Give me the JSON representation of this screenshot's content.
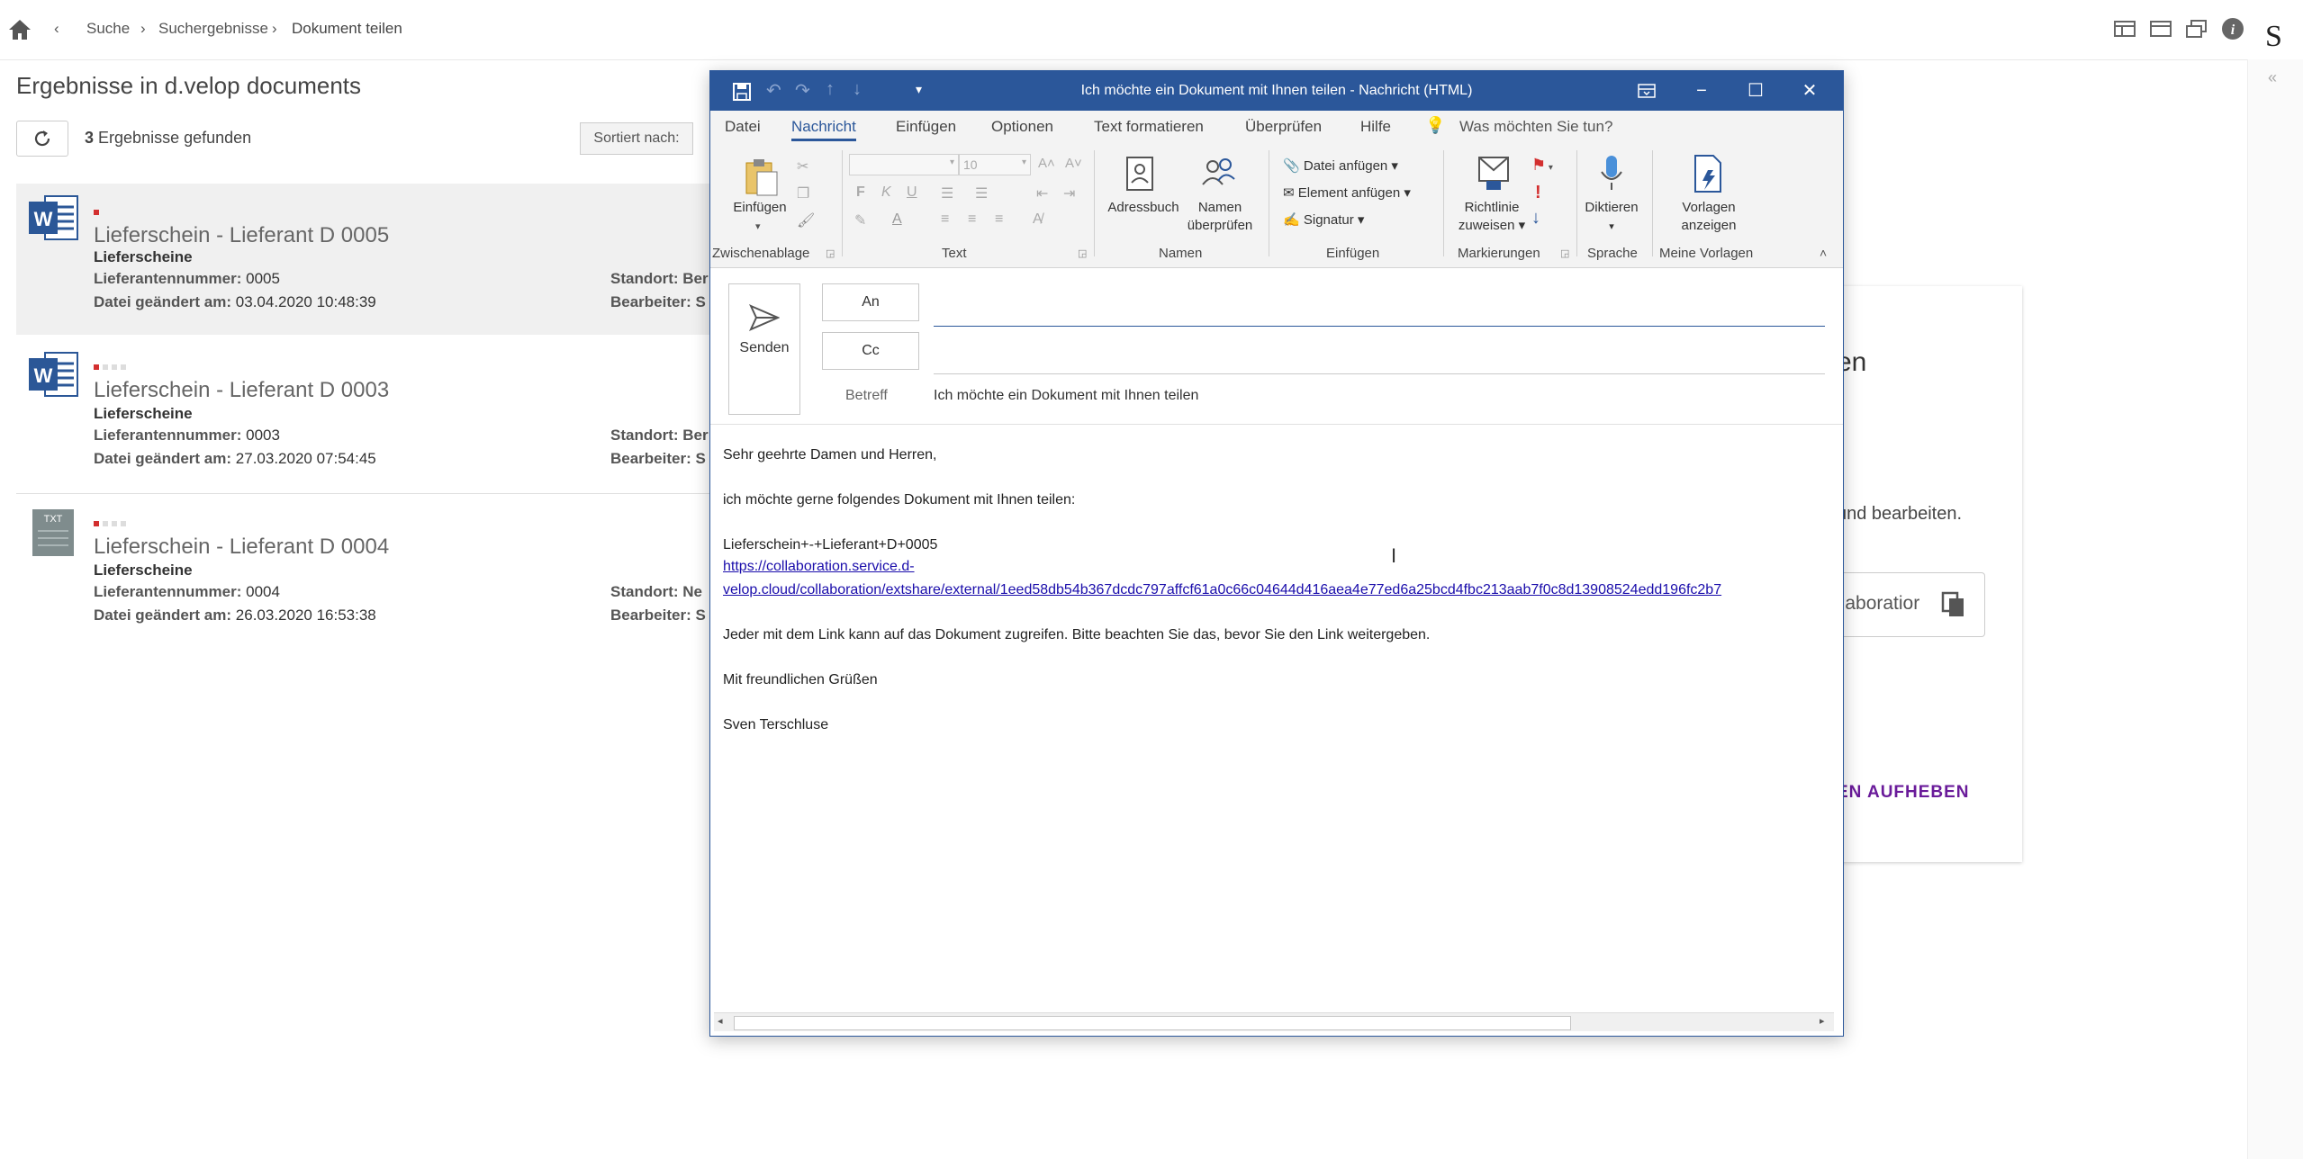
{
  "breadcrumb": {
    "home": "home",
    "items": [
      "Suche",
      "Suchergebnisse",
      "Dokument teilen"
    ]
  },
  "results": {
    "title": "Ergebnisse in d.velop documents",
    "count_num": "3",
    "count_text": "Ergebnisse gefunden",
    "sort_label": "Sortiert nach:",
    "items": [
      {
        "icon": "word-icon",
        "title": "Lieferschein - Lieferant D 0005",
        "category": "Lieferscheine",
        "f1_label": "Lieferantennummer:",
        "f1_value": "0005",
        "f2_label": "Datei geändert am:",
        "f2_value": "03.04.2020 10:48:39",
        "r1": "Standort: Ber",
        "r2": "Bearbeiter: S"
      },
      {
        "icon": "word-icon",
        "title": "Lieferschein - Lieferant D 0003",
        "category": "Lieferscheine",
        "f1_label": "Lieferantennummer:",
        "f1_value": "0003",
        "f2_label": "Datei geändert am:",
        "f2_value": "27.03.2020 07:54:45",
        "r1": "Standort: Ber",
        "r2": "Bearbeiter: S"
      },
      {
        "icon": "txt-icon",
        "title": "Lieferschein - Lieferant D 0004",
        "category": "Lieferscheine",
        "f1_label": "Lieferantennummer:",
        "f1_value": "0004",
        "f2_label": "Datei geändert am:",
        "f2_value": "26.03.2020 16:53:38",
        "r1": "Standort: Ne",
        "r2": "Bearbeiter: S"
      }
    ]
  },
  "background_panel": {
    "heading_fragment": "en",
    "text_fragment": "und bearbeiten.",
    "button_fragment": "llaboratior",
    "action_fragment": "EN AUFHEBEN"
  },
  "window": {
    "title": "Ich möchte ein Dokument mit Ihnen teilen  -  Nachricht (HTML)",
    "menu": [
      "Datei",
      "Nachricht",
      "Einfügen",
      "Optionen",
      "Text formatieren",
      "Überprüfen",
      "Hilfe"
    ],
    "tell_me": "Was möchten Sie tun?",
    "ribbon": {
      "paste": "Einfügen",
      "font_size": "10",
      "addressbook": "Adressbuch",
      "check_names_1": "Namen",
      "check_names_2": "überprüfen",
      "attach_file": "Datei anfügen",
      "attach_item": "Element anfügen",
      "signature": "Signatur",
      "policy_1": "Richtlinie",
      "policy_2": "zuweisen",
      "dictate": "Diktieren",
      "templates_1": "Vorlagen",
      "templates_2": "anzeigen",
      "groups": [
        "Zwischenablage",
        "Text",
        "Namen",
        "Einfügen",
        "Markierungen",
        "Sprache",
        "Meine Vorlagen"
      ]
    },
    "send": "Senden",
    "to": "An",
    "cc": "Cc",
    "subject_label": "Betreff",
    "subject": "Ich möchte ein Dokument mit Ihnen teilen",
    "body": {
      "greeting": "Sehr geehrte Damen und Herren,",
      "intro": "ich möchte gerne folgendes Dokument mit Ihnen teilen:",
      "docname": "Lieferschein+-+Lieferant+D+0005",
      "link1": "https://collaboration.service.d-",
      "link2": "velop.cloud/collaboration/extshare/external/1eed58db54b367dcdc797affcf61a0c66c04644d416aea4e77ed6a25bcd4fbc213aab7f0c8d13908524edd196fc2b7",
      "warning": "Jeder mit dem Link kann auf das Dokument zugreifen. Bitte beachten Sie das, bevor Sie den Link weitergeben.",
      "closing": "Mit freundlichen Grüßen",
      "signature": "Sven Terschluse"
    }
  },
  "colors": {
    "outlook_blue": "#2b579a",
    "word_blue": "#2b5797",
    "accent_purple": "#6a1b9a",
    "flag_red": "#d32f2f"
  }
}
